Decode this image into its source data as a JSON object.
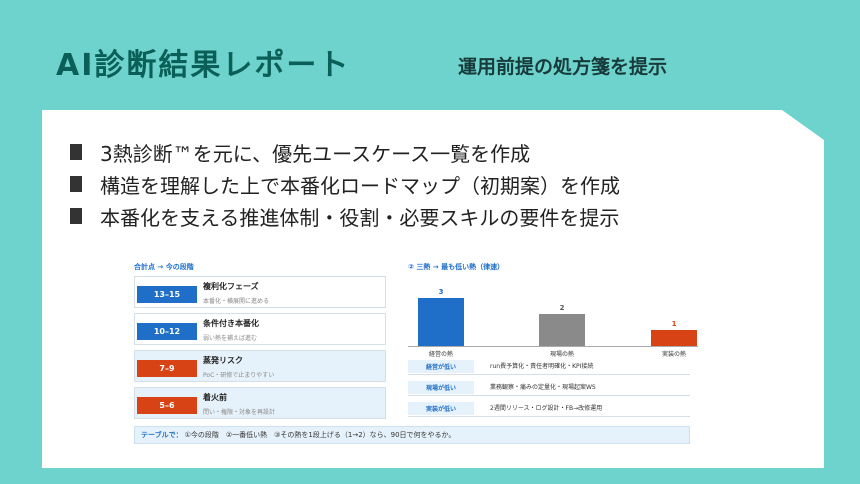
{
  "header": {
    "title": "AI診断結果レポート",
    "subtitle": "運用前提の処方箋を提示"
  },
  "bullets": [
    "3熱診断™を元に、優先ユースケース一覧を作成",
    "構造を理解した上で本番化ロードマップ（初期案）を作成",
    "本番化を支える推進体制・役割・必要スキルの要件を提示"
  ],
  "embedded": {
    "left_heading": "合計点 → 今の段階",
    "right_heading": "② 三熱 → 最も低い熱（律速）",
    "stages": [
      {
        "range": "13–15",
        "name": "複利化フェーズ",
        "desc": "本番化・横展開に進める",
        "color": "#1f6fc9"
      },
      {
        "range": "10–12",
        "name": "条件付き本番化",
        "desc": "弱い熱を補えば進む",
        "color": "#1f6fc9"
      },
      {
        "range": "7–9",
        "name": "蒸発リスク",
        "desc": "PoC・研修で止まりやすい",
        "color": "#d84315"
      },
      {
        "range": "5–6",
        "name": "着火前",
        "desc": "問い・権限・対象を再設計",
        "color": "#d84315"
      }
    ],
    "rows": [
      {
        "key": "経営が低い",
        "value": "run費予算化・責任者明確化・KPI接続"
      },
      {
        "key": "現場が低い",
        "value": "業務観察・痛みの定量化・現場起案WS"
      },
      {
        "key": "実装が低い",
        "value": "2週間リリース・ログ設計・FB→改修運用"
      }
    ],
    "footer_key": "テーブルで：",
    "footer_text": "①今の段階　②一番低い熱　③その熱を1段上げる（1→2）なら、90日で何をやるか。"
  },
  "chart_data": {
    "type": "bar",
    "categories": [
      "経営の熱",
      "現場の熱",
      "実装の熱"
    ],
    "values": [
      3,
      2,
      1
    ],
    "colors": [
      "#1f6fc9",
      "#8a8a8a",
      "#d84315"
    ],
    "ylim": [
      0,
      3
    ]
  }
}
